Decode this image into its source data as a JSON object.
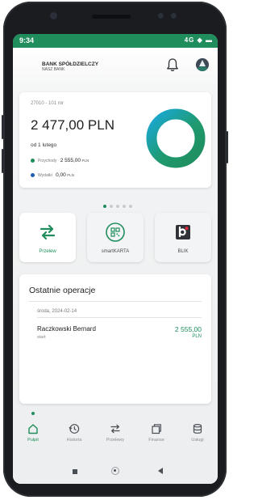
{
  "status_bar": {
    "time": "9:34",
    "icons": "4G ◆ ▬"
  },
  "bank": {
    "name_line1": "BANK SPÓŁDZIELCZY",
    "name_line2": "NASZ BANK"
  },
  "account": {
    "number_masked": "27010 - 101 ror",
    "balance": "2 477,00 PLN",
    "since_label": "od 1 lutego",
    "income_label": "Przychody",
    "income_amount": "2 555,00",
    "income_currency": "PLN",
    "expense_label": "Wydatki",
    "expense_amount": "0,00",
    "expense_currency": "PLN",
    "donut_fraction_income": 1.0,
    "colors": {
      "income": "#1f8d5c",
      "expense": "#1e5fb0",
      "donut_inner": "#1aa8d8"
    }
  },
  "carousel": {
    "count": 5,
    "active_index": 0
  },
  "tiles": [
    {
      "label": "Przelew",
      "icon": "transfer-arrows-icon"
    },
    {
      "label": "smartKARTA",
      "icon": "qr-card-icon"
    },
    {
      "label": "BLIK",
      "icon": "blik-icon"
    }
  ],
  "operations": {
    "title": "Ostatnie operacje",
    "date": "środa, 2024-02-14",
    "items": [
      {
        "name": "Raczkowski Bernard",
        "type": "start",
        "amount": "2 555,00",
        "currency": "PLN"
      }
    ]
  },
  "tabbar": {
    "active": "Pulpit",
    "items": [
      {
        "label": "Pulpit",
        "icon": "home-icon"
      },
      {
        "label": "Historia",
        "icon": "history-icon"
      },
      {
        "label": "Przelewy",
        "icon": "transfers-icon"
      },
      {
        "label": "Finanse",
        "icon": "finance-icon"
      },
      {
        "label": "Usługi",
        "icon": "services-icon"
      }
    ]
  },
  "theme": {
    "accent": "#1f8d5c"
  }
}
